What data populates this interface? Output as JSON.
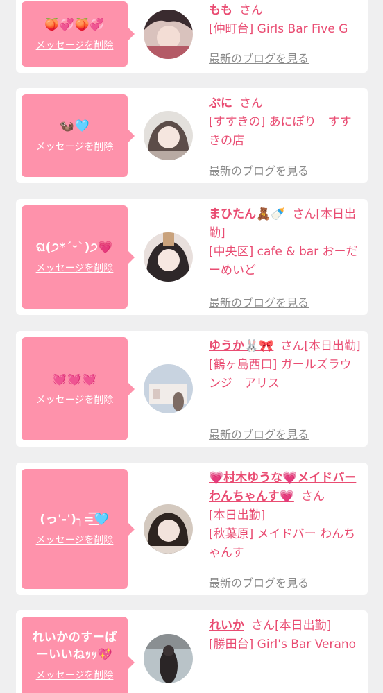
{
  "delete_label": "メッセージを削除",
  "blog_label": "最新のブログを見る",
  "san": "さん",
  "posts": [
    {
      "message": "🍑💞🍑💞",
      "name": "もも",
      "status": "",
      "shop": "[仲町台] Girls Bar Five G",
      "avatar_colors": [
        "#d9c2bd",
        "#3a2b2f",
        "#b45a66"
      ]
    },
    {
      "message": "🦦🩵",
      "name": "ぷに",
      "status": "",
      "shop": "[すすきの] あにぽり　すすきの店",
      "avatar_colors": [
        "#e3e0dc",
        "#5c4d49",
        "#b8aaa3"
      ]
    },
    {
      "message": "ଘ(੭*ˊᵕˋ)੭💗",
      "name": "まひたん🧸🍼",
      "status": "[本日出勤]",
      "shop": "[中央区] cafe & bar おーだーめいど",
      "avatar_colors": [
        "#e8dfdc",
        "#2e2729",
        "#c9a27c"
      ]
    },
    {
      "message": "💓💓💓",
      "name": "ゆうか🐰🎀",
      "status": "[本日出勤]",
      "shop": "[鶴ヶ島西口] ガールズラウンジ　アリス",
      "avatar_colors": [
        "#c8d3e0",
        "#f1ece9",
        "#7d6b63"
      ]
    },
    {
      "message": "(っ'-')╮=͟͟͞͞🩵",
      "name": "💗村木ゆうな💗メイドバーわんちゃんす💗",
      "status": "[本日出勤]",
      "shop": "[秋葉原] メイドバー わんちゃんす",
      "avatar_colors": [
        "#d4c9bf",
        "#2d2420",
        "#e2d7cf"
      ]
    },
    {
      "message": "れいかのすーぱーいいねｯｯ💖",
      "name": "れいか",
      "status": "[本日出勤]",
      "shop": "[勝田台] Girl's Bar Verano",
      "avatar_colors": [
        "#b9c3c8",
        "#2a2526",
        "#8a8f92"
      ]
    }
  ]
}
